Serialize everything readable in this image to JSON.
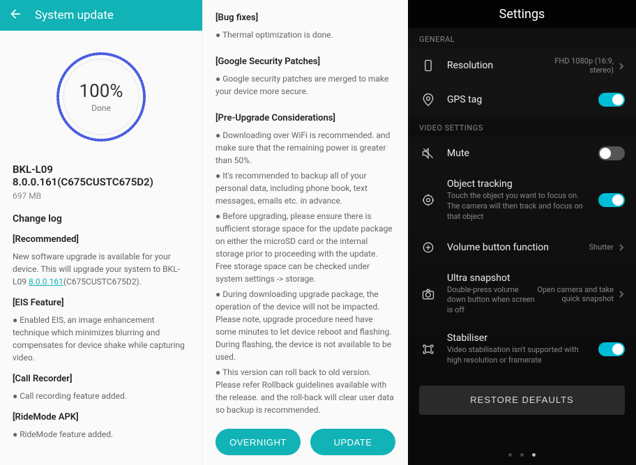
{
  "panel1": {
    "header_title": "System update",
    "progress_percent": "100%",
    "progress_label": "Done",
    "version": "BKL-L09 8.0.0.161(C675CUSTC675D2)",
    "size": "697 MB",
    "changelog_heading": "Change log",
    "recommended_heading": "[Recommended]",
    "recommended_body": "New software upgrade is available for your device. This will upgrade your system to BKL-L09 ",
    "recommended_link": "8.0.0.161",
    "recommended_tail": "(C675CUSTC675D2).",
    "eis_heading": "[EIS Feature]",
    "eis_bullet": "● Enabled EIS, an image enhancement technique which minimizes blurring and compensates for device shake while capturing video.",
    "call_heading": "[Call Recorder]",
    "call_bullet": "● Call recording feature added.",
    "ride_heading": "[RideMode APK]",
    "ride_bullet": "● RideMode feature added."
  },
  "panel2": {
    "bug_heading": "[Bug fixes]",
    "bug_bullet": "● Thermal optimization is done.",
    "gsp_heading": "[Google Security Patches]",
    "gsp_bullet": "● Google security patches are merged to make your device more secure.",
    "pre_heading": "[Pre-Upgrade Considerations]",
    "pre_b1": "● Downloading over WiFi is recommended. and make sure that the remaining power is greater than 50%.",
    "pre_b2": "● It's recommended to backup all of your personal data, including phone book, text messages, emails etc. in advance.",
    "pre_b3": "● Before upgrading, please ensure there is sufficient storage space for the update package on either the microSD card or the internal storage prior to proceeding with the update. Free storage space can be checked under system settings -> storage.",
    "pre_b4": "● During downloading upgrade package, the operation of the device will not be impacted. Please note, upgrade procedure need have some minutes to let device reboot and flashing. During flashing, the device is not available to be used.",
    "pre_b5": "● This version can roll back to old version. Please refer Rollback guidelines available with the release. and the roll-back will clear user data so backup is recommended.",
    "btn_overnight": "OVERNIGHT",
    "btn_update": "UPDATE"
  },
  "panel3": {
    "title": "Settings",
    "group_general": "GENERAL",
    "group_video": "VIDEO SETTINGS",
    "items": {
      "resolution": {
        "title": "Resolution",
        "value": "FHD 1080p (16:9, stereo)"
      },
      "gps": {
        "title": "GPS tag"
      },
      "mute": {
        "title": "Mute"
      },
      "tracking": {
        "title": "Object tracking",
        "sub": "Touch the object you want to focus on. The camera will then track and focus on that object"
      },
      "volbtn": {
        "title": "Volume button function",
        "value": "Shutter"
      },
      "ultra": {
        "title": "Ultra snapshot",
        "sub": "Double-press volume down button when screen is off",
        "value": "Open camera and take quick snapshot"
      },
      "stab": {
        "title": "Stabiliser",
        "sub": "Video stabilisation isn't supported with high resolution or framerate"
      }
    },
    "restore": "RESTORE DEFAULTS"
  }
}
